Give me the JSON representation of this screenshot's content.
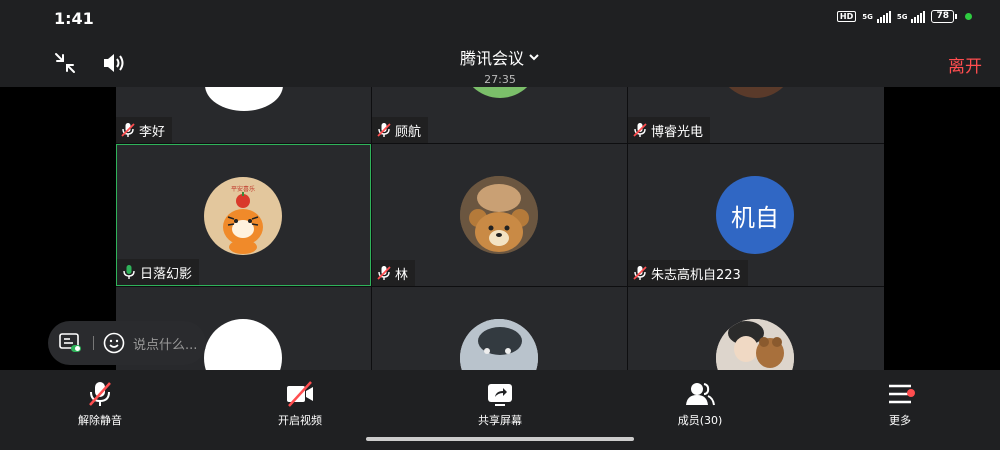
{
  "status_bar": {
    "time": "1:41",
    "hd_label": "HD",
    "net1": "5G",
    "net2": "5G",
    "battery": "78"
  },
  "header": {
    "title": "腾讯会议",
    "duration": "27:35",
    "leave_label": "离开",
    "leave_color": "#ff4d4f"
  },
  "participants": [
    {
      "name": "李好",
      "mic": "muted",
      "avatar": "blue-white-avatar"
    },
    {
      "name": "顾航",
      "mic": "muted",
      "avatar": "green-field-avatar"
    },
    {
      "name": "博睿光电",
      "mic": "muted",
      "avatar": "photo-avatar"
    },
    {
      "name": "日落幻影",
      "mic": "active",
      "avatar": "tiger-avatar",
      "badge_text": "平安喜乐"
    },
    {
      "name": "林",
      "mic": "muted",
      "avatar": "bear-avatar"
    },
    {
      "name": "朱志高机自223",
      "mic": "muted",
      "avatar_text": "机自",
      "avatar_color": "#3067c4"
    },
    {
      "avatar": "white-avatar"
    },
    {
      "avatar": "dark-photo-avatar"
    },
    {
      "avatar": "person-bear-avatar"
    }
  ],
  "chat": {
    "placeholder": "说点什么..."
  },
  "toolbar": {
    "unmute": "解除静音",
    "video": "开启视频",
    "share": "共享屏幕",
    "members": "成员(30)",
    "more": "更多"
  },
  "colors": {
    "active_border": "#2fb35a",
    "mic_active": "#2fb35a",
    "mic_muted": "#ff4d4f",
    "background": "#1f2022"
  }
}
